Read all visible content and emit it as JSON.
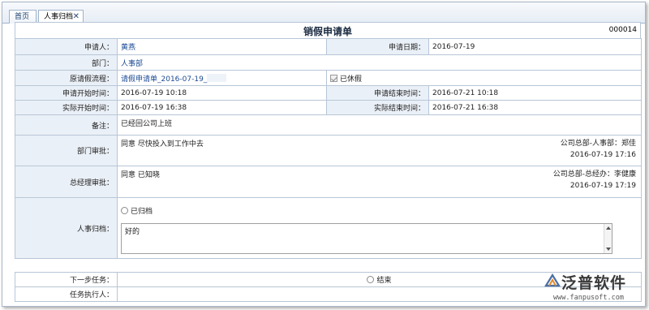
{
  "tabs": [
    {
      "label": "首页",
      "active": false
    },
    {
      "label": "人事归档",
      "active": true
    }
  ],
  "form": {
    "title": "销假申请单",
    "doc_no": "000014",
    "applicant_label": "申请人：",
    "applicant": "黄燕",
    "apply_date_label": "申请日期：",
    "apply_date": "2016-07-19",
    "dept_label": "部门：",
    "dept": "人事部",
    "orig_flow_label": "原请假流程：",
    "orig_flow": "请假申请单_2016-07-19_",
    "rested_label": "已休假",
    "apply_start_label": "申请开始时间：",
    "apply_start": "2016-07-19 10:18",
    "apply_end_label": "申请结束时间：",
    "apply_end": "2016-07-21 10:18",
    "actual_start_label": "实际开始时间：",
    "actual_start": "2016-07-19 16:38",
    "actual_end_label": "实际结束时间：",
    "actual_end": "2016-07-21 16:38",
    "remark_label": "备注：",
    "remark": "已经回公司上班",
    "dept_approval_label": "部门审批：",
    "dept_approval_text": "同意  尽快投入到工作中去",
    "dept_approval_by": "公司总部-人事部：郑佳",
    "dept_approval_time": "2016-07-19 17:16",
    "gm_approval_label": "总经理审批：",
    "gm_approval_text": "同意  已知晓",
    "gm_approval_by": "公司总部-总经办：李健康",
    "gm_approval_time": "2016-07-19 17:19",
    "hr_archive_label": "人事归档：",
    "archived_option": "已归档",
    "hr_comment": "好的"
  },
  "next": {
    "next_task_label": "下一步任务：",
    "end_option": "结束",
    "executor_label": "任务执行人：",
    "executor": ""
  },
  "brand": {
    "name": "泛普软件",
    "url": "www.fanpusoft.com"
  }
}
